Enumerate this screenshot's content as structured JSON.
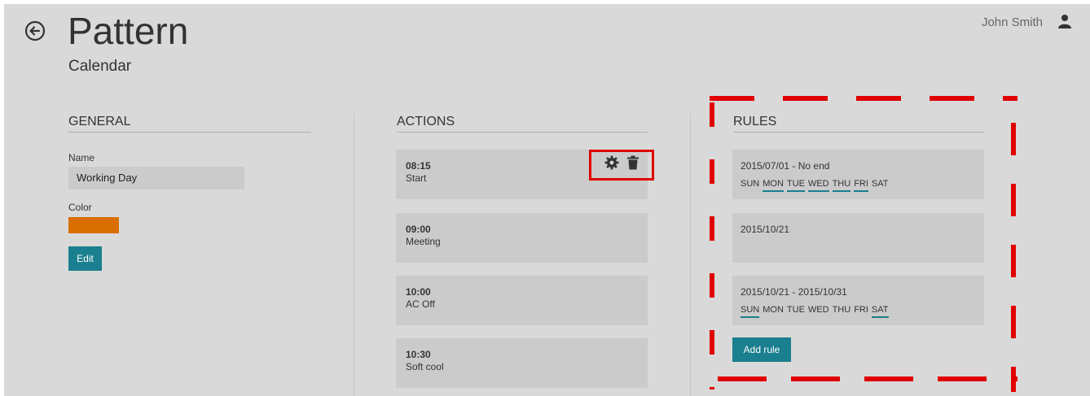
{
  "header": {
    "title": "Pattern",
    "subtitle": "Calendar",
    "back_icon": "circle-arrow-left-icon",
    "user_name": "John Smith",
    "user_icon": "user-icon"
  },
  "general": {
    "heading": "GENERAL",
    "name_label": "Name",
    "name_value": "Working Day",
    "color_label": "Color",
    "color_value": "#d96e00",
    "edit_label": "Edit"
  },
  "actions": {
    "heading": "ACTIONS",
    "items": [
      {
        "time": "08:15",
        "label": "Start"
      },
      {
        "time": "09:00",
        "label": "Meeting"
      },
      {
        "time": "10:00",
        "label": "AC Off"
      },
      {
        "time": "10:30",
        "label": "Soft cool"
      }
    ],
    "settings_icon": "gear-icon",
    "delete_icon": "trash-icon"
  },
  "rules": {
    "heading": "RULES",
    "items": [
      {
        "range": "2015/07/01 - No end",
        "days": [
          "SUN",
          "MON",
          "TUE",
          "WED",
          "THU",
          "FRI",
          "SAT"
        ],
        "active": [
          false,
          true,
          true,
          true,
          true,
          true,
          false
        ]
      },
      {
        "range": "2015/10/21"
      },
      {
        "range": "2015/10/21 - 2015/10/31",
        "days": [
          "SUN",
          "MON",
          "TUE",
          "WED",
          "THU",
          "FRI",
          "SAT"
        ],
        "active": [
          true,
          false,
          false,
          false,
          false,
          false,
          true
        ]
      }
    ],
    "add_label": "Add rule"
  },
  "colors": {
    "accent": "#1a7f8e",
    "highlight": "#e00000",
    "swatch": "#d96e00"
  }
}
